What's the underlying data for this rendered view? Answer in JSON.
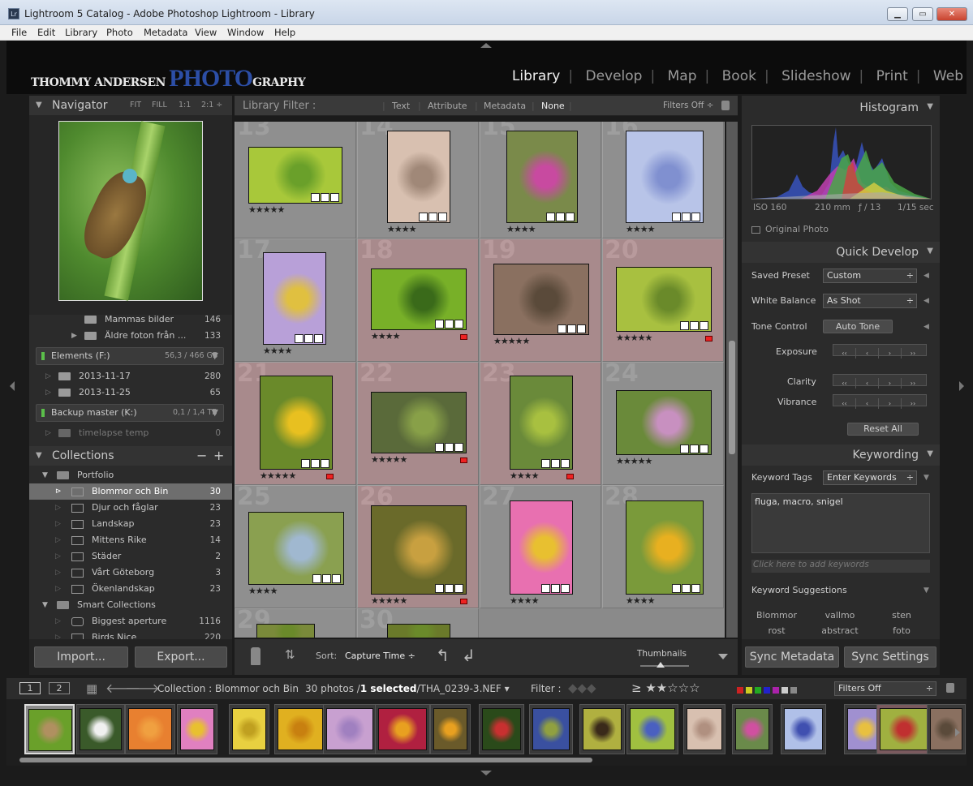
{
  "window": {
    "title": "Lightroom 5 Catalog - Adobe Photoshop Lightroom - Library",
    "app_icon": "Lr"
  },
  "menu": [
    "File",
    "Edit",
    "Library",
    "Photo",
    "Metadata",
    "View",
    "Window",
    "Help"
  ],
  "brand": {
    "part1": "THOMMY ANDERSEN ",
    "part2": "PHOTO",
    "part3": "GRAPHY"
  },
  "modules": [
    "Library",
    "Develop",
    "Map",
    "Book",
    "Slideshow",
    "Print",
    "Web"
  ],
  "navigator": {
    "title": "Navigator",
    "zoom": [
      "FIT",
      "FILL",
      "1:1",
      "2:1 ÷"
    ]
  },
  "folders": [
    {
      "name": "Mammas bilder",
      "count": "146"
    },
    {
      "name": "Äldre foton från ...",
      "count": "133"
    }
  ],
  "volumes": [
    {
      "name": "Elements (F:)",
      "size": "56,3 / 466 GB"
    },
    {
      "name": "Backup master (K:)",
      "size": "0,1 / 1,4 TB"
    }
  ],
  "dated_folders": [
    {
      "name": "2013-11-17",
      "count": "280"
    },
    {
      "name": "2013-11-25",
      "count": "65"
    }
  ],
  "timelapse": {
    "name": "timelapse temp",
    "count": "0"
  },
  "collections": {
    "title": "Collections",
    "portfolio": "Portfolio",
    "items": [
      {
        "name": "Blommor och Bin",
        "count": "30"
      },
      {
        "name": "Djur och fåglar",
        "count": "23"
      },
      {
        "name": "Landskap",
        "count": "23"
      },
      {
        "name": "Mittens Rike",
        "count": "14"
      },
      {
        "name": "Städer",
        "count": "2"
      },
      {
        "name": "Vårt Göteborg",
        "count": "3"
      },
      {
        "name": "Ökenlandskap",
        "count": "23"
      }
    ],
    "smart": "Smart Collections",
    "smart_items": [
      {
        "name": "Biggest aperture",
        "count": "1116"
      },
      {
        "name": "Birds Nice",
        "count": "220"
      }
    ]
  },
  "left_buttons": {
    "import": "Import...",
    "export": "Export..."
  },
  "filterbar": {
    "label": "Library Filter :",
    "opts": [
      "Text",
      "Attribute",
      "Metadata",
      "None"
    ],
    "state": "Filters Off ÷"
  },
  "grid_numbers": [
    "13",
    "14",
    "15",
    "16",
    "17",
    "18",
    "19",
    "20",
    "21",
    "22",
    "23",
    "24",
    "25",
    "26",
    "27",
    "28",
    "29",
    "30"
  ],
  "grid_stars": [
    "★★★★★",
    "★★★★",
    "★★★★",
    "★★★★",
    "★★★★",
    "★★★★",
    "★★★★★",
    "★★★★★",
    "★★★★★",
    "★★★★★",
    "★★★★",
    "★★★★★",
    "★★★★",
    "★★★★★",
    "★★★★",
    "★★★★"
  ],
  "toolbar": {
    "sort_label": "Sort:",
    "sort_value": "Capture Time",
    "thumbnails": "Thumbnails"
  },
  "histogram": {
    "title": "Histogram",
    "iso": "ISO 160",
    "focal": "210 mm",
    "aperture": "ƒ / 13",
    "shutter": "1/15 sec",
    "original": "Original Photo"
  },
  "quick_develop": {
    "title": "Quick Develop",
    "saved_preset": "Saved Preset",
    "preset_value": "Custom",
    "white_balance": "White Balance",
    "wb_value": "As Shot",
    "tone_control": "Tone Control",
    "auto_tone": "Auto Tone",
    "exposure": "Exposure",
    "clarity": "Clarity",
    "vibrance": "Vibrance",
    "reset": "Reset All"
  },
  "keywording": {
    "title": "Keywording",
    "tags_label": "Keyword Tags",
    "tags_value": "Enter Keywords",
    "keywords": "fluga, macro, snigel",
    "add_placeholder": "Click here to add keywords",
    "suggestions": "Keyword Suggestions",
    "suggest_items": [
      "Blommor",
      "vallmo",
      "sten",
      "rost",
      "abstract",
      "foto"
    ]
  },
  "sync": {
    "metadata": "Sync Metadata",
    "settings": "Sync Settings"
  },
  "filmbar": {
    "screen1": "1",
    "screen2": "2",
    "source": "Collection : Blommor och Bin",
    "count": "30 photos /",
    "selected": "1 selected",
    "file": "/THA_0239-3.NEF ▾",
    "filter": "Filter :",
    "filters_off": "Filters Off"
  }
}
